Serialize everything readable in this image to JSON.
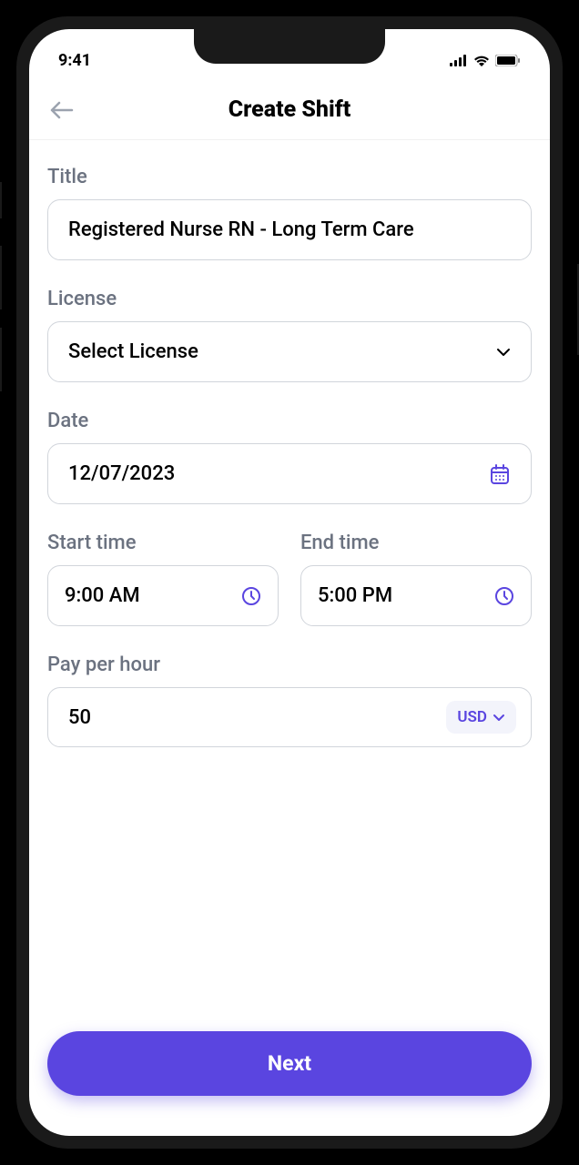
{
  "status": {
    "time": "9:41"
  },
  "header": {
    "title": "Create Shift"
  },
  "form": {
    "title": {
      "label": "Title",
      "value": "Registered Nurse RN - Long Term Care"
    },
    "license": {
      "label": "License",
      "placeholder": "Select License"
    },
    "date": {
      "label": "Date",
      "value": "12/07/2023"
    },
    "start_time": {
      "label": "Start time",
      "value": "9:00 AM"
    },
    "end_time": {
      "label": "End time",
      "value": "5:00 PM"
    },
    "pay": {
      "label": "Pay per hour",
      "value": "50",
      "currency": "USD"
    }
  },
  "footer": {
    "next_label": "Next"
  },
  "colors": {
    "accent": "#5a45e0"
  }
}
